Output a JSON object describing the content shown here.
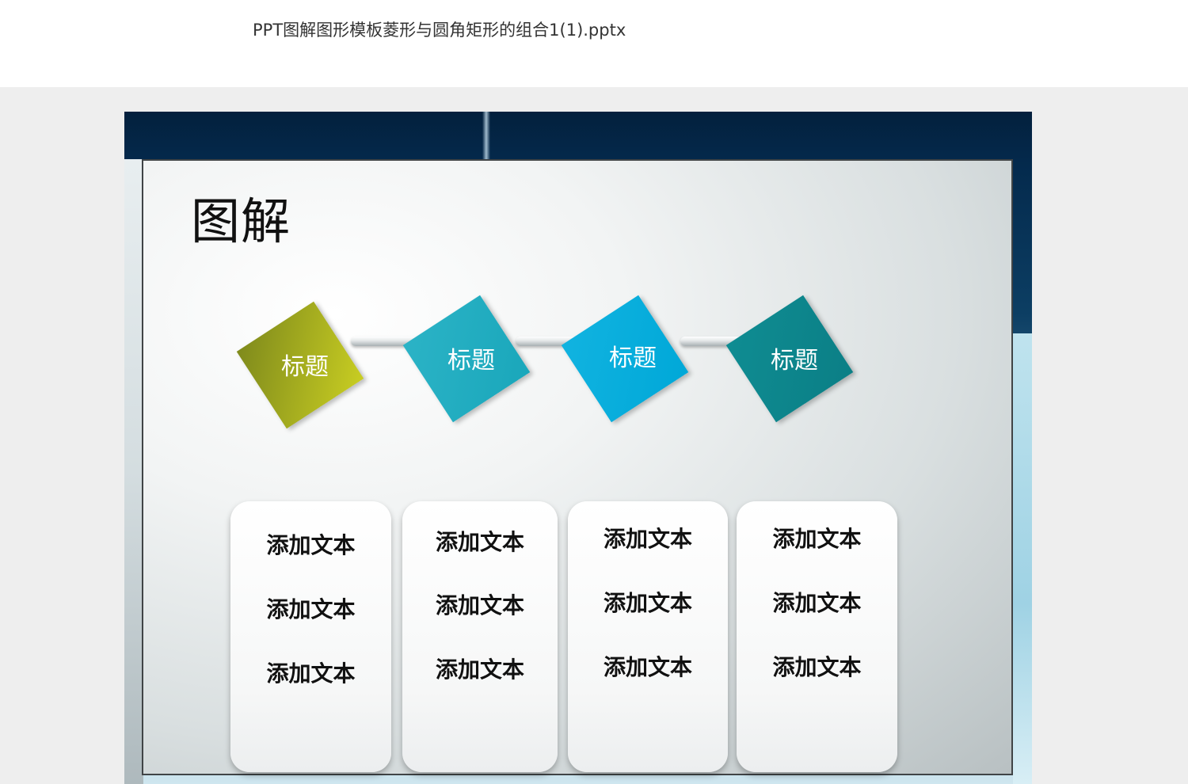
{
  "file": {
    "title": "PPT图解图形模板菱形与圆角矩形的组合1(1).pptx"
  },
  "slide": {
    "heading": "图解",
    "steps": [
      {
        "label": "标题",
        "color_from": "#7f8a1c",
        "color_to": "#c8cd22"
      },
      {
        "label": "标题",
        "color_from": "#2bb3c6",
        "color_to": "#1aa7bb"
      },
      {
        "label": "标题",
        "color_from": "#11b3e0",
        "color_to": "#00a8d8"
      },
      {
        "label": "标题",
        "color_from": "#0f8c92",
        "color_to": "#0b7f86"
      }
    ],
    "cards": [
      {
        "items": [
          "添加文本",
          "添加文本",
          "添加文本"
        ]
      },
      {
        "items": [
          "添加文本",
          "添加文本",
          "添加文本"
        ]
      },
      {
        "items": [
          "添加文本",
          "添加文本",
          "添加文本"
        ]
      },
      {
        "items": [
          "添加文本",
          "添加文本",
          "添加文本"
        ]
      }
    ]
  }
}
